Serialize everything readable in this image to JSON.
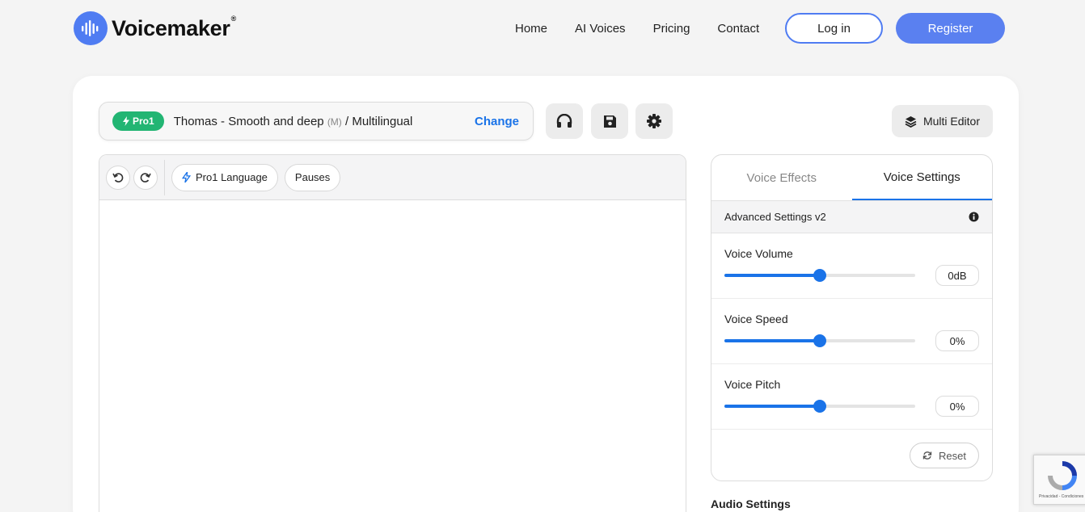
{
  "header": {
    "logo_text": "Voicemaker",
    "logo_reg": "®",
    "nav": [
      "Home",
      "AI Voices",
      "Pricing",
      "Contact"
    ],
    "login_label": "Log in",
    "register_label": "Register"
  },
  "voice": {
    "badge": "Pro1",
    "name": "Thomas - Smooth and deep",
    "gender": "(M)",
    "language": "/ Multilingual",
    "change_label": "Change"
  },
  "toolbar_icons": [
    "headphones-icon",
    "save-icon",
    "gear-icon"
  ],
  "multi_editor_label": "Multi Editor",
  "editor": {
    "chips": [
      "Pro1 Language",
      "Pauses"
    ],
    "text": ""
  },
  "settings": {
    "tabs": [
      "Voice Effects",
      "Voice Settings"
    ],
    "active_tab": "Voice Settings",
    "advanced_label": "Advanced Settings v2",
    "sliders": [
      {
        "label": "Voice Volume",
        "value": "0dB",
        "level": 0.5
      },
      {
        "label": "Voice Speed",
        "value": "0%",
        "level": 0.5
      },
      {
        "label": "Voice Pitch",
        "value": "0%",
        "level": 0.5
      }
    ],
    "reset_label": "Reset"
  },
  "audio_settings_label": "Audio Settings",
  "recaptcha_text": "Privacidad - Condiciones",
  "colors": {
    "accent": "#1a73e8",
    "brand": "#5a80f0",
    "badge": "#22b573"
  }
}
